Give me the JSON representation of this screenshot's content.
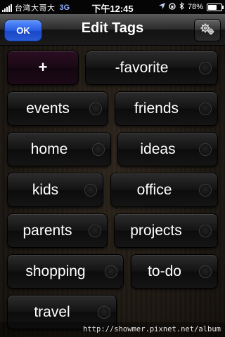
{
  "status_bar": {
    "carrier": "台湾大哥大",
    "network": "3G",
    "time": "下午12:45",
    "battery": "78%",
    "battery_level": 0.78
  },
  "nav": {
    "ok_label": "OK",
    "title": "Edit Tags"
  },
  "tags": {
    "add_label": "+",
    "favorite": "-favorite",
    "events": "events",
    "friends": "friends",
    "home": "home",
    "ideas": "ideas",
    "kids": "kids",
    "office": "office",
    "parents": "parents",
    "projects": "projects",
    "shopping": "shopping",
    "todo": "to-do",
    "travel": "travel"
  },
  "watermark": "http://showmer.pixnet.net/album"
}
